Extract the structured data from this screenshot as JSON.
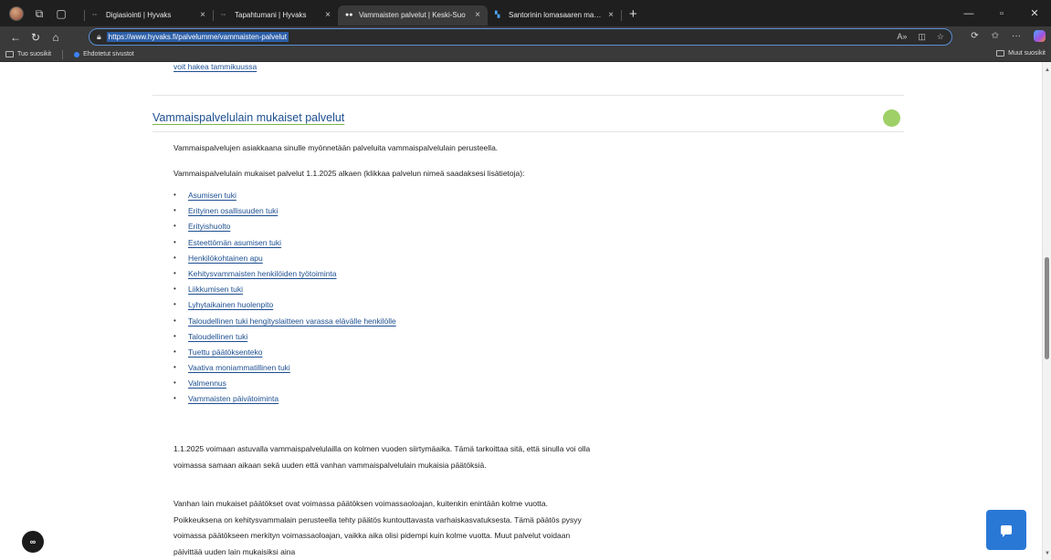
{
  "browser": {
    "tabs": [
      {
        "label": "Digiasiointi | Hyvaks",
        "active": false
      },
      {
        "label": "Tapahtumani | Hyvaks",
        "active": false
      },
      {
        "label": "Vammaisten palvelut | Keski-Suo",
        "active": true
      },
      {
        "label": "Santorinin lomasaaren maanjärist",
        "active": false
      }
    ],
    "url": "https://www.hyvaks.fi/palvelumme/vammaisten-palvelut",
    "favorites_bar": {
      "items": [
        "Tuo suosikit",
        "Ehdotetut sivustot"
      ],
      "other": "Muut suosikit"
    }
  },
  "page": {
    "previous_link": "voit hakea tammikuussa",
    "section_title": "Vammaispalvelulain mukaiset palvelut",
    "intro": "Vammaispalvelujen asiakkaana sinulle myönnetään palveluita vammaispalvelulain perusteella.",
    "services_intro": "Vammaispalvelulain mukaiset palvelut 1.1.2025 alkaen (klikkaa palvelun nimeä saadaksesi lisätietoja):",
    "services": [
      "Asumisen tuki",
      "Erityinen osallisuuden tuki",
      "Erityishuolto",
      "Esteettömän asumisen tuki",
      "Henkilökohtainen apu",
      "Kehitysvammaisten henkilöiden työtoiminta",
      "Liikkumisen tuki",
      "Lyhytaikainen huolenpito",
      "Taloudellinen tuki hengityslaitteen varassa elävälle henkilölle",
      "Taloudellinen tuki",
      "Tuettu päätöksenteko",
      "Vaativa moniammatillinen tuki",
      "Valmennus",
      "Vammaisten päivätoiminta"
    ],
    "transition_p1": "1.1.2025 voimaan astuvalla vammaispalvelulailla on kolmen vuoden siirtymäaika. Tämä tarkoittaa sitä, että sinulla voi olla voimassa samaan aikaan sekä uuden että vanhan vammaispalvelulain mukaisia päätöksiä.",
    "transition_p2": "Vanhan lain mukaiset päätökset ovat voimassa päätöksen voimassaoloajan, kuitenkin enintään kolme vuotta. Poikkeuksena on kehitysvammalain perusteella tehty päätös kuntouttavasta varhaiskasvatuksesta. Tämä päätös pysyy voimassa päätökseen merkityn voimassaoloajan, vaikka aika olisi pidempi kuin kolme vuotta. Muut palvelut voidaan päivittää uuden lain mukaisiksi aina"
  },
  "colors": {
    "link": "#1d4f91",
    "accent_green": "#9fd067",
    "chat_button": "#2a78d6"
  }
}
